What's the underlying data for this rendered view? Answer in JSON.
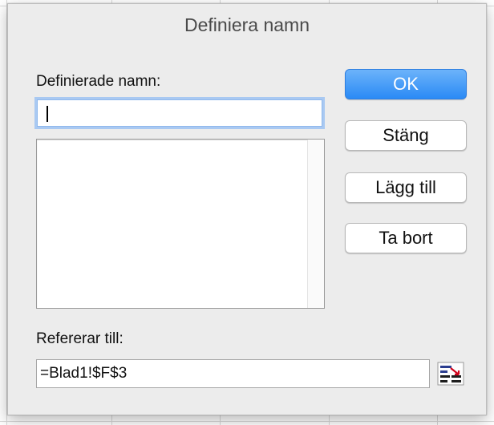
{
  "dialog": {
    "title": "Definiera namn",
    "names_label": "Definierade namn:",
    "name_input_value": "",
    "defined_names": [],
    "refers_label": "Refererar till:",
    "refers_value": "=Blad1!$F$3"
  },
  "buttons": {
    "ok": "OK",
    "close": "Stäng",
    "add": "Lägg till",
    "delete": "Ta bort"
  },
  "colors": {
    "primary_button": "#2a8af5",
    "focus_ring": "#a9c9f2"
  },
  "icons": {
    "range_selector": "collapse-range-icon"
  }
}
